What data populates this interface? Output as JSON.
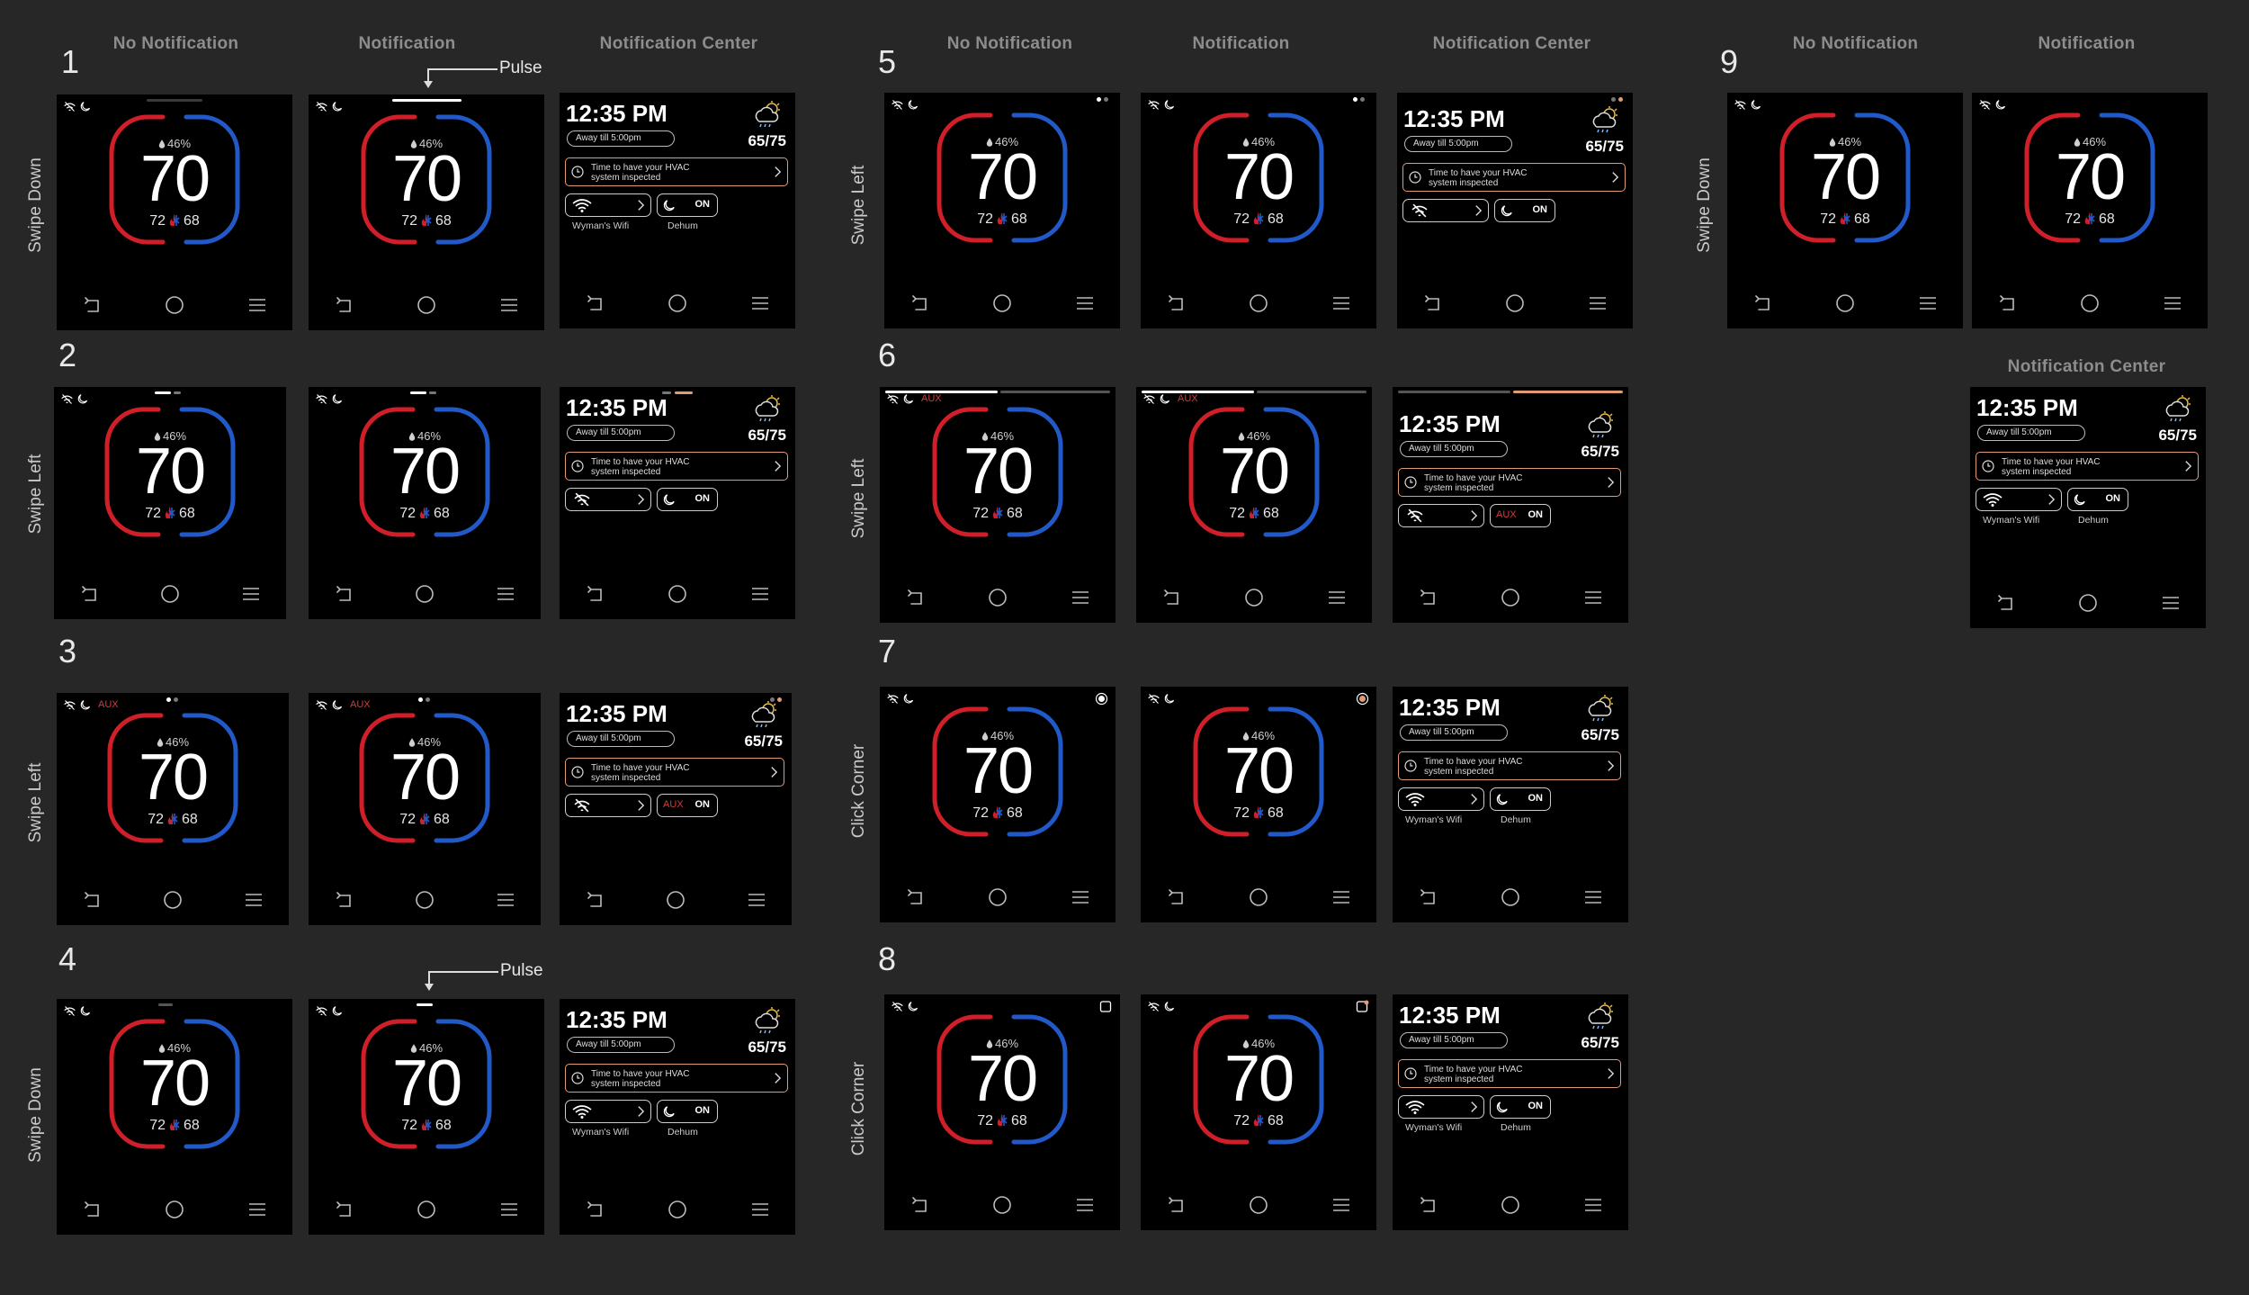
{
  "column_headers": {
    "no_notification": "No Notification",
    "notification": "Notification",
    "notification_center": "Notification Center"
  },
  "annotations": {
    "pulse": "Pulse"
  },
  "gestures": {
    "swipe_down": "Swipe Down",
    "swipe_left": "Swipe Left",
    "click_corner": "Click Corner"
  },
  "scenario_numbers": [
    "1",
    "2",
    "3",
    "4",
    "5",
    "6",
    "7",
    "8",
    "9"
  ],
  "thermostat": {
    "humidity": "46%",
    "current_temp": "70",
    "heat_setpoint": "72",
    "cool_setpoint": "68",
    "aux_label": "AUX"
  },
  "notification_center": {
    "time": "12:35 PM",
    "away": "Away till 5:00pm",
    "temp_range": "65/75",
    "notification_line1": "Time to have your HVAC",
    "notification_line2": "system inspected",
    "wifi_label": "Wyman's Wifi",
    "dehum_label": "Dehum",
    "on_label": "ON",
    "aux_label": "AUX"
  },
  "colors": {
    "background": "#272727",
    "screen": "#000000",
    "heat": "#d11f2a",
    "cool": "#2259c9",
    "accent": "#e39b76"
  },
  "icons": [
    "wifi-off-icon",
    "dehumidify-icon",
    "droplet-icon",
    "flame-icon",
    "snowflake-icon",
    "back-icon",
    "home-icon",
    "menu-icon",
    "clock-icon",
    "chevron-right-icon",
    "wifi-icon",
    "weather-icon",
    "corner-icon"
  ]
}
